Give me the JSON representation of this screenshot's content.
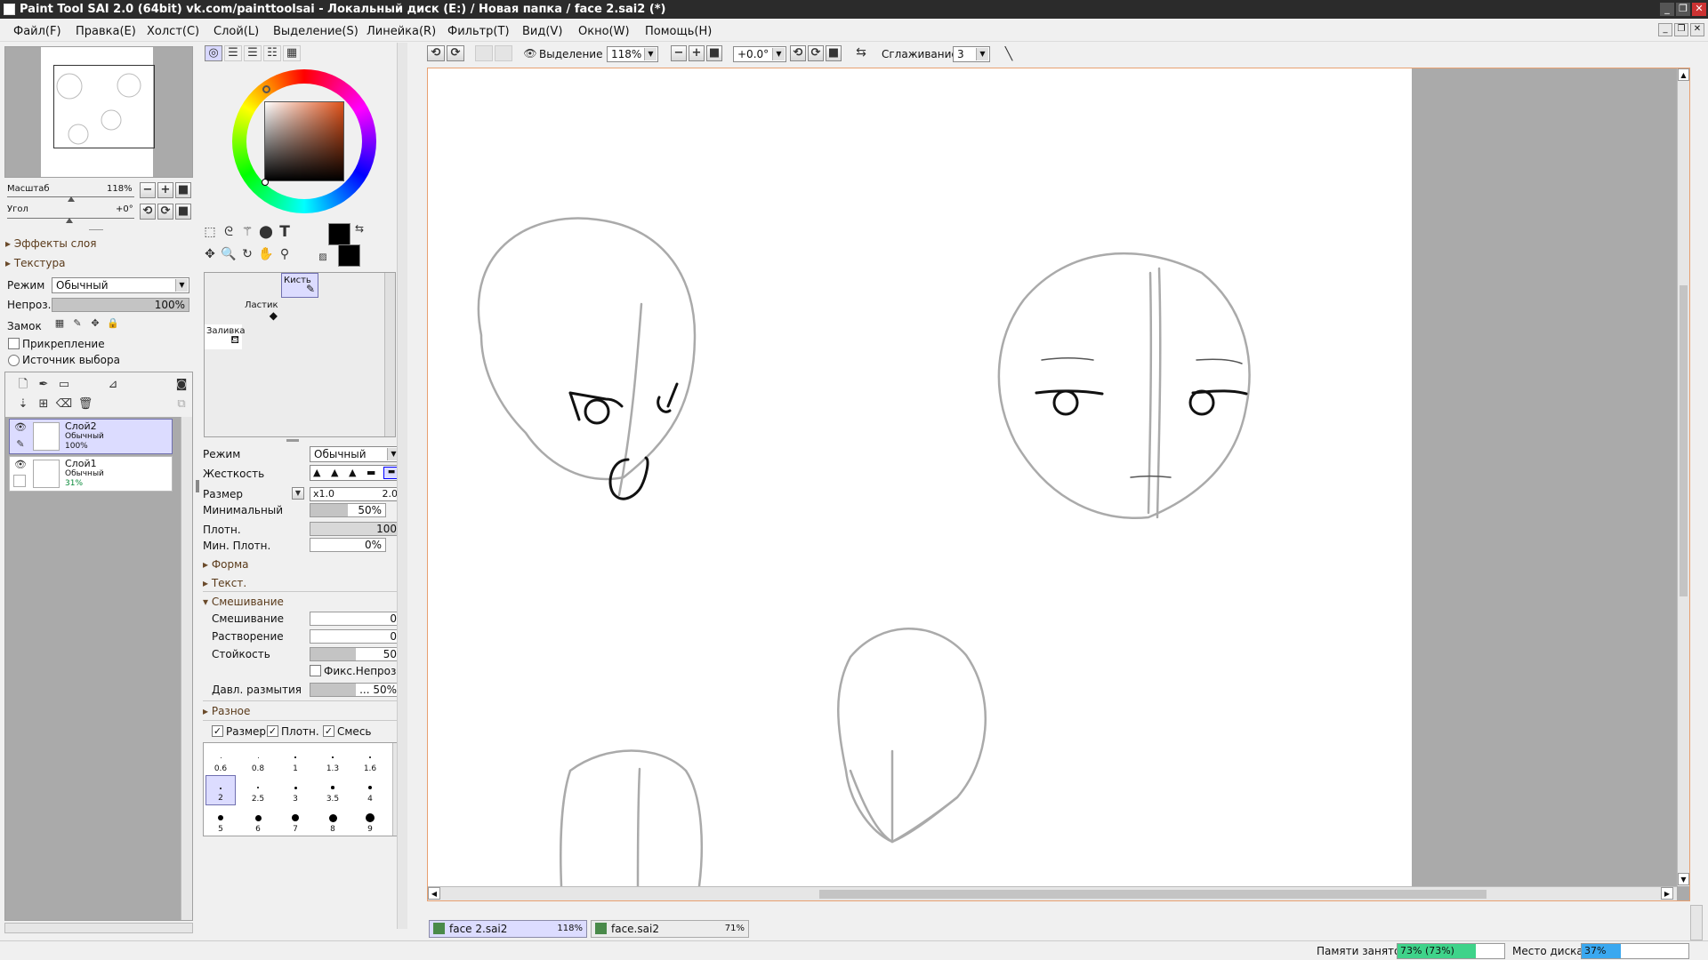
{
  "window": {
    "title": "Paint Tool SAI 2.0 (64bit) vk.com/painttoolsai - Локальный диск (E:) / Новая папка / face 2.sai2 (*)"
  },
  "menu": [
    "Файл(F)",
    "Правка(E)",
    "Холст(C)",
    "Слой(L)",
    "Выделение(S)",
    "Линейка(R)",
    "Фильтр(T)",
    "Вид(V)",
    "Окно(W)",
    "Помощь(H)"
  ],
  "navigator": {
    "zoom_label": "Масштаб",
    "zoom_value": "118%",
    "angle_label": "Угол",
    "angle_value": "+0°"
  },
  "layer_panel": {
    "effects_label": "Эффекты слоя",
    "texture_label": "Текстура",
    "mode_label": "Режим",
    "mode_value": "Обычный",
    "opacity_label": "Непроз.",
    "opacity_value": "100%",
    "lock_label": "Замок",
    "clipping_label": "Прикрепление",
    "selection_source_label": "Источник выбора",
    "layers": [
      {
        "name": "Слой2",
        "mode": "Обычный",
        "opacity": "100%",
        "selected": true
      },
      {
        "name": "Слой1",
        "mode": "Обычный",
        "opacity": "31%",
        "selected": false
      }
    ]
  },
  "tools": {
    "tool_slots": [
      {
        "label": "Кисть",
        "selected": true
      },
      {
        "label": "Ластик",
        "selected": false
      },
      {
        "label": "Заливка",
        "selected": false
      }
    ]
  },
  "brush_settings": {
    "mode_label": "Режим",
    "mode_value": "Обычный",
    "hardness_label": "Жесткость",
    "size_label": "Размер",
    "size_multiplier": "x1.0",
    "size_value": "2.0",
    "min_size_label": "Минимальный",
    "min_size_value": "50%",
    "density_label": "Плотн.",
    "density_value": "100",
    "min_density_label": "Мин. Плотн.",
    "min_density_value": "0%",
    "shape_label": "Форма",
    "texture_label": "Текст.",
    "blending_section": "Смешивание",
    "blending_label": "Смешивание",
    "blending_value": "0",
    "dilution_label": "Растворение",
    "dilution_value": "0",
    "persistence_label": "Стойкость",
    "persistence_value": "50",
    "keep_opacity_label": "Фикс.Непрозр.",
    "blur_pressure_label": "Давл. размытия",
    "blur_pressure_value": "... 50%",
    "misc_label": "Разное",
    "pressure_size_label": "Размер",
    "pressure_density_label": "Плотн.",
    "pressure_blend_label": "Смесь",
    "brush_sizes": [
      "0.6",
      "0.8",
      "1",
      "1.3",
      "1.6",
      "2",
      "2.5",
      "3",
      "3.5",
      "4",
      "5",
      "6",
      "7",
      "8",
      "9"
    ]
  },
  "canvas_toolbar": {
    "selection_label": "Выделение",
    "zoom_value": "118%",
    "angle_value": "+0.0°",
    "stabilizer_label": "Сглаживание",
    "stabilizer_value": "3"
  },
  "documents": [
    {
      "name": "face 2.sai2",
      "zoom": "118%",
      "active": true
    },
    {
      "name": "face.sai2",
      "zoom": "71%",
      "active": false
    }
  ],
  "status": {
    "memory_label": "Памяти занято",
    "memory_value": "73% (73%)",
    "memory_fraction": 0.73,
    "disk_label": "Место диска",
    "disk_value": "37%",
    "disk_fraction": 0.37
  },
  "colors": {
    "titlebar": "#2b2b2b",
    "selected_layer": "#dcdcff",
    "memory_bar": "#3fd38a",
    "disk_bar": "#3aa8f0"
  }
}
